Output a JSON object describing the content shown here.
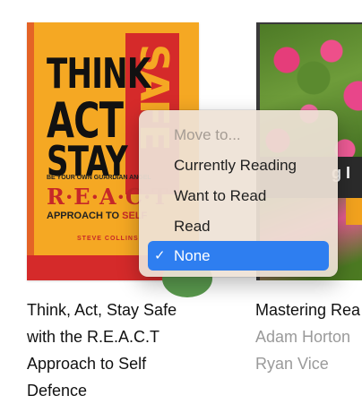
{
  "books": [
    {
      "cover_lines": [
        "THINK",
        "ACT",
        "STAY"
      ],
      "cover_side_word": "SAFE",
      "cover_tagline": "BE YOUR OWN GUARDIAN ANGEL",
      "cover_react": "R·E·A·C·T",
      "cover_approach": "APPROACH TO",
      "cover_approach_red": "SELF",
      "cover_author": "STEVE COLLINS",
      "title": "Think, Act, Stay Safe with the R.E.A.C.T Approach to Self Defence",
      "badge_color": "#5a9a4e"
    },
    {
      "cover_banner": "g I",
      "title": "Mastering Rea",
      "authors": [
        "Adam Horton",
        "Ryan Vice"
      ]
    }
  ],
  "menu": {
    "header": "Move to...",
    "items": [
      "Currently Reading",
      "Want to Read",
      "Read",
      "None"
    ],
    "selected": "None",
    "check_glyph": "✓"
  },
  "colors": {
    "selection": "#2e7ef0",
    "cover_orange": "#f5a823",
    "cover_red": "#d52a2a"
  }
}
